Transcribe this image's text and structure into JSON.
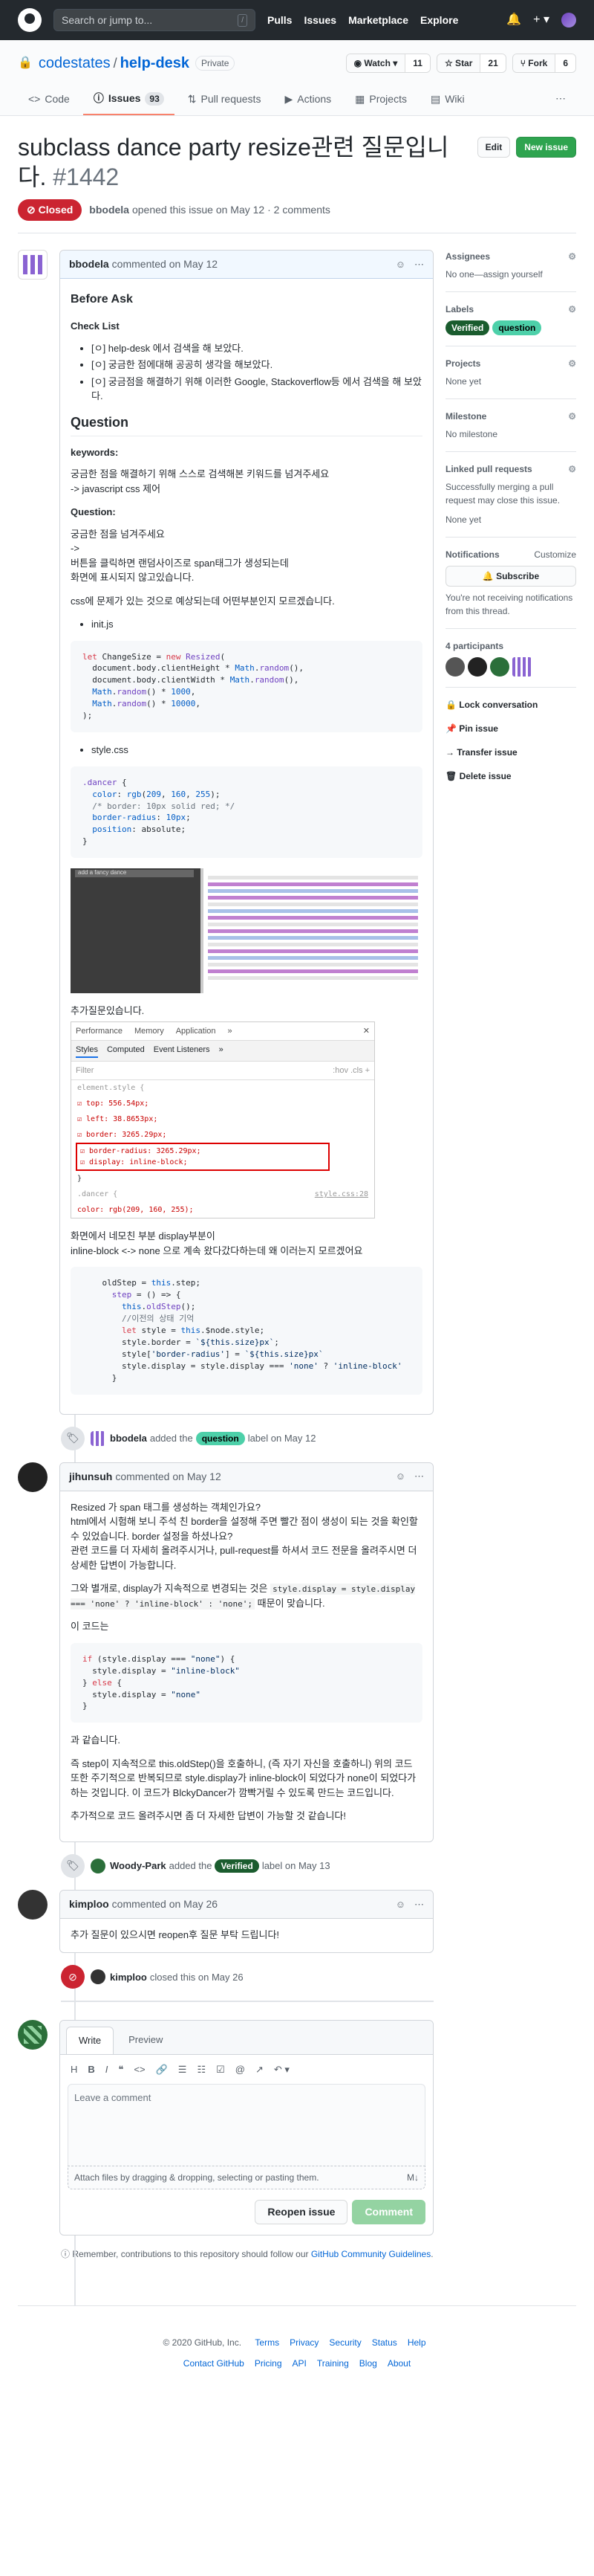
{
  "header": {
    "search_placeholder": "Search or jump to...",
    "slash": "/",
    "nav": [
      "Pulls",
      "Issues",
      "Marketplace",
      "Explore"
    ],
    "plus": "+ ▾"
  },
  "repo": {
    "owner": "codestates",
    "name": "help-desk",
    "visibility": "Private",
    "watch": "◉ Watch ▾",
    "watch_count": "11",
    "star": "☆ Star",
    "star_count": "21",
    "fork": "⑂ Fork",
    "fork_count": "6"
  },
  "tabs": [
    {
      "icon": "<>",
      "label": "Code"
    },
    {
      "icon": "ⓘ",
      "label": "Issues",
      "count": "93"
    },
    {
      "icon": "⇅",
      "label": "Pull requests"
    },
    {
      "icon": "▶",
      "label": "Actions"
    },
    {
      "icon": "▦",
      "label": "Projects"
    },
    {
      "icon": "▤",
      "label": "Wiki"
    }
  ],
  "issue": {
    "title": "subclass dance party resize관련 질문입니다.",
    "number": "#1442",
    "edit": "Edit",
    "new_issue": "New issue",
    "state": "⊘ Closed",
    "author": "bbodela",
    "meta": "opened this issue on May 12 · 2 comments"
  },
  "c1": {
    "author": "bbodela",
    "date": "commented on May 12",
    "h_before": "Before Ask",
    "checklist_title": "Check List",
    "checklist": [
      "[ㅇ] help-desk 에서 검색을 해 보았다.",
      "[ㅇ] 궁금한 점에대해 공공히 생각을 해보았다.",
      "[ㅇ] 궁금점을 해결하기 위해 이러한 Google, Stackoverflow등 에서 검색을 해 보았다."
    ],
    "h_question": "Question",
    "kw_title": "keywords:",
    "kw_lines": [
      "궁금한 점을 해결하기 위해 스스로 검색해본 키워드를 넘겨주세요",
      "-> javascript css 제어"
    ],
    "q_title": "Question:",
    "q_lines": [
      "궁금한 점을 넘겨주세요",
      "->",
      "버튼을 클릭하면 랜덤사이즈로 span태그가 생성되는데",
      "화면에 표시되지 않고있습니다."
    ],
    "q_last": "css에 문제가 있는 것으로 예상되는데 어떤부분인지 모르겠습니다.",
    "f1": "init.js",
    "f2": "style.css",
    "shot1_caption": "add a fancy dance",
    "added_caption": "추가질문있습니다.",
    "devtools_tabs": [
      "Performance",
      "Memory",
      "Application",
      "»"
    ],
    "devtools_tabs2": [
      "Styles",
      "Computed",
      "Event Listeners",
      "»"
    ],
    "filter": "Filter",
    ":hov": ":hov .cls +",
    "styles": [
      "element.style {",
      "☑ top: 556.54px;",
      "☑ left: 38.8653px;",
      "☑ border: 3265.29px;"
    ],
    "styles_red": [
      "☑ border-radius: 3265.29px;",
      "☑ display: inline-block;"
    ],
    "styles_after": [
      "}",
      ".dancer {",
      "  color: rgb(209, 160, 255);"
    ],
    "styles_ref": "style.css:28",
    "after_lines": [
      "화면에서 네모친 부분 display부분이",
      "inline-block <-> none 으로 계속 왔다갔다하는데 왜 이러는지 모르겠어요"
    ]
  },
  "ev1": {
    "actor": "bbodela",
    "text": "added the",
    "label": "question",
    "suffix": "label on May 12",
    "color": "#4dd0a9"
  },
  "c2": {
    "author": "jihunsuh",
    "date": "commented on May 12",
    "p1": [
      "Resized 가 span 태그를 생성하는 객체인가요?",
      "html에서 시험해 보니 주석 친 border을 설정해 주면 빨간 점이 생성이 되는 것을 확인할 수 있었습니다. border 설정을 하셨나요?",
      "관련 코드를 더 자세히 올려주시거나, pull-request를 하셔서 코드 전문을 올려주시면 더 상세한 답변이 가능합니다."
    ],
    "p2_a": "그와 별개로, display가 지속적으로 변경되는 것은 ",
    "p2_code": "style.display = style.display === 'none' ? 'inline-block' : 'none';",
    "p2_b": " 때문이 맞습니다.",
    "p3": "이 코드는",
    "p4": "과 같습니다.",
    "p5": "즉 step이 지속적으로 this.oldStep()을 호출하니, (즉 자기 자신을 호출하니) 위의 코드 또한 주기적으로 반복되므로 style.display가 inline-block이 되었다가 none이 되었다가 하는 것입니다. 이 코드가 BlckyDancer가 깜빡거릴 수 있도록 만드는 코드입니다.",
    "p6": "추가적으로 코드 올려주시면 좀 더 자세한 답변이 가능할 것 같습니다!"
  },
  "ev2": {
    "actor": "Woody-Park",
    "text": "added the",
    "label": "Verified",
    "suffix": "label on May 13",
    "color": "#1a5c2e"
  },
  "c3": {
    "author": "kimploo",
    "date": "commented on May 26",
    "text": "추가 질문이 있으시면 reopen후 질문 부탁 드립니다!"
  },
  "ev3": {
    "actor": "kimploo",
    "text": "closed this on May 26"
  },
  "editor": {
    "write": "Write",
    "preview": "Preview",
    "placeholder": "Leave a comment",
    "attach": "Attach files by dragging & dropping, selecting or pasting them.",
    "md": "M↓",
    "reopen": "Reopen issue",
    "submit": "Comment",
    "tools": [
      "H",
      "B",
      "I",
      "❝",
      "<>",
      "🔗",
      "☰",
      "☷",
      "☑",
      "@",
      "↗",
      "↶ ▾"
    ]
  },
  "remember": {
    "pre": "ⓘ Remember, contributions to this repository should follow our ",
    "link": "GitHub Community Guidelines",
    "post": "."
  },
  "sidebar": {
    "assignees": "Assignees",
    "assignees_val": "No one—assign yourself",
    "labels": "Labels",
    "label1": "Verified",
    "label1_color": "#1a5c2e",
    "label2": "question",
    "label2_color": "#4dd0a9",
    "projects": "Projects",
    "projects_val": "None yet",
    "milestone": "Milestone",
    "milestone_val": "No milestone",
    "linked": "Linked pull requests",
    "linked_desc": "Successfully merging a pull request may close this issue.",
    "linked_val": "None yet",
    "notif": "Notifications",
    "customize": "Customize",
    "subscribe": "🔔 Subscribe",
    "notif_desc": "You're not receiving notifications from this thread.",
    "participants": "4 participants",
    "lock": "🔒 Lock conversation",
    "pin": "📌 Pin issue",
    "transfer": "→ Transfer issue",
    "delete": "🗑 Delete issue",
    "gear": "⚙"
  },
  "footer": {
    "copy": "© 2020 GitHub, Inc.",
    "links1": [
      "Terms",
      "Privacy",
      "Security",
      "Status",
      "Help"
    ],
    "links2": [
      "Contact GitHub",
      "Pricing",
      "API",
      "Training",
      "Blog",
      "About"
    ]
  }
}
